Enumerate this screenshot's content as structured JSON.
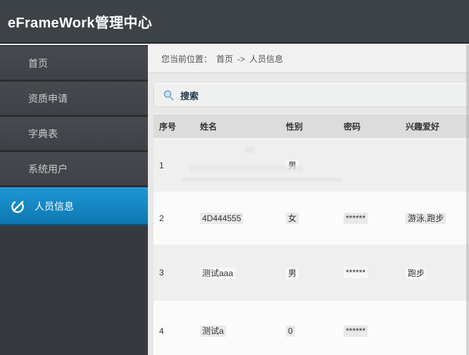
{
  "app": {
    "title": "eFrameWork管理中心"
  },
  "sidebar": {
    "items": [
      {
        "label": "首页",
        "active": false
      },
      {
        "label": "资质申请",
        "active": false
      },
      {
        "label": "字典表",
        "active": false
      },
      {
        "label": "系统用户",
        "active": false
      },
      {
        "label": "人员信息",
        "active": true
      }
    ]
  },
  "breadcrumb": {
    "label": "您当前位置：",
    "home": "首页",
    "arrow": "->",
    "current": "人员信息"
  },
  "search": {
    "label": "搜索"
  },
  "icons": {
    "active_item_icon": "gauge-icon",
    "search_icon": "magnifier-icon"
  },
  "table": {
    "columns": [
      "序号",
      "姓名",
      "性别",
      "密码",
      "兴趣爱好"
    ],
    "rows": [
      {
        "no": "1",
        "name": "",
        "gender": "男",
        "password": "",
        "hobby": ""
      },
      {
        "no": "2",
        "name": "4D444555",
        "gender": "女",
        "password": "******",
        "hobby": "游泳,跑步"
      },
      {
        "no": "3",
        "name": "测试aaa",
        "gender": "男",
        "password": "******",
        "hobby": "跑步"
      },
      {
        "no": "4",
        "name": "测试a",
        "gender": "0",
        "password": "******",
        "hobby": ""
      }
    ]
  },
  "colors": {
    "header_bg": "#3d4247",
    "sidebar_bg": "#36393d",
    "active_item_blue": "#1389c9",
    "content_bg": "#e8e8e8",
    "breadcrumb_bg": "#f1f1f1",
    "table_header_bg": "#dcdcdc",
    "row_odd": "#efefef",
    "row_even": "#fbfbfb",
    "text_dark": "#333333"
  }
}
